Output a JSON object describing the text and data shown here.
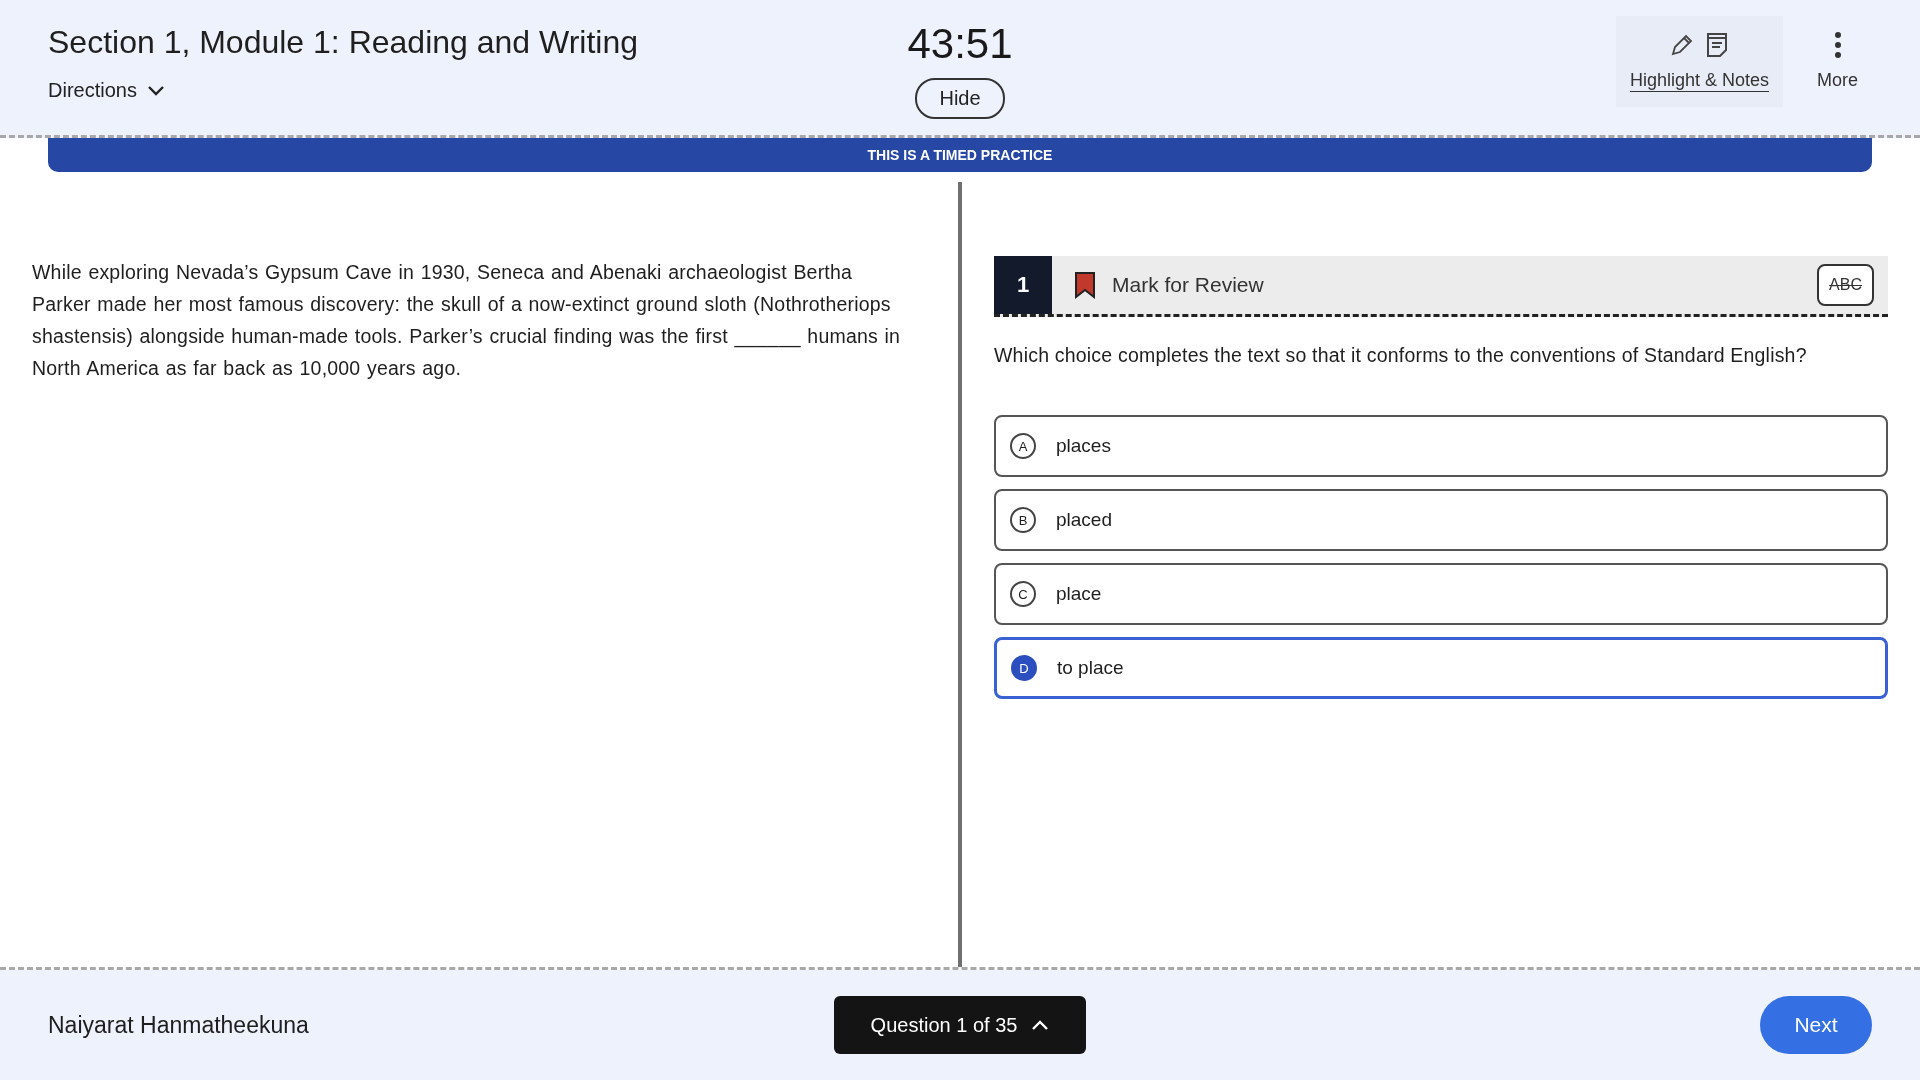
{
  "header": {
    "title": "Section 1, Module 1: Reading and Writing",
    "directions": "Directions",
    "timer": "43:51",
    "hide_button": "Hide",
    "tools": [
      {
        "kind": "highlight",
        "label": "Highlight & Notes"
      },
      {
        "kind": "more",
        "label": "More"
      }
    ]
  },
  "banner": "THIS IS A TIMED PRACTICE",
  "passage": "While exploring Nevada’s Gypsum Cave in 1930, Seneca and Abenaki archaeologist Bertha Parker made her most famous discovery: the skull of a now-extinct ground sloth (Nothrotheriops shastensis) alongside human-made tools. Parker’s crucial finding was the first ______ humans in North America as far back as 10,000 years ago.",
  "question": {
    "number": "1",
    "mark_for_review": "Mark for Review",
    "marked": true,
    "eliminator": "ABC",
    "prompt": "Which choice completes the text so that it conforms to the conventions of Standard English?",
    "options": [
      {
        "letter": "A",
        "text": "places",
        "selected": false
      },
      {
        "letter": "B",
        "text": "placed",
        "selected": false
      },
      {
        "letter": "C",
        "text": "place",
        "selected": false
      },
      {
        "letter": "D",
        "text": "to place",
        "selected": true
      }
    ]
  },
  "footer": {
    "student": "Naiyarat Hanmatheekuna",
    "navigator": "Question 1 of 35",
    "next": "Next"
  }
}
